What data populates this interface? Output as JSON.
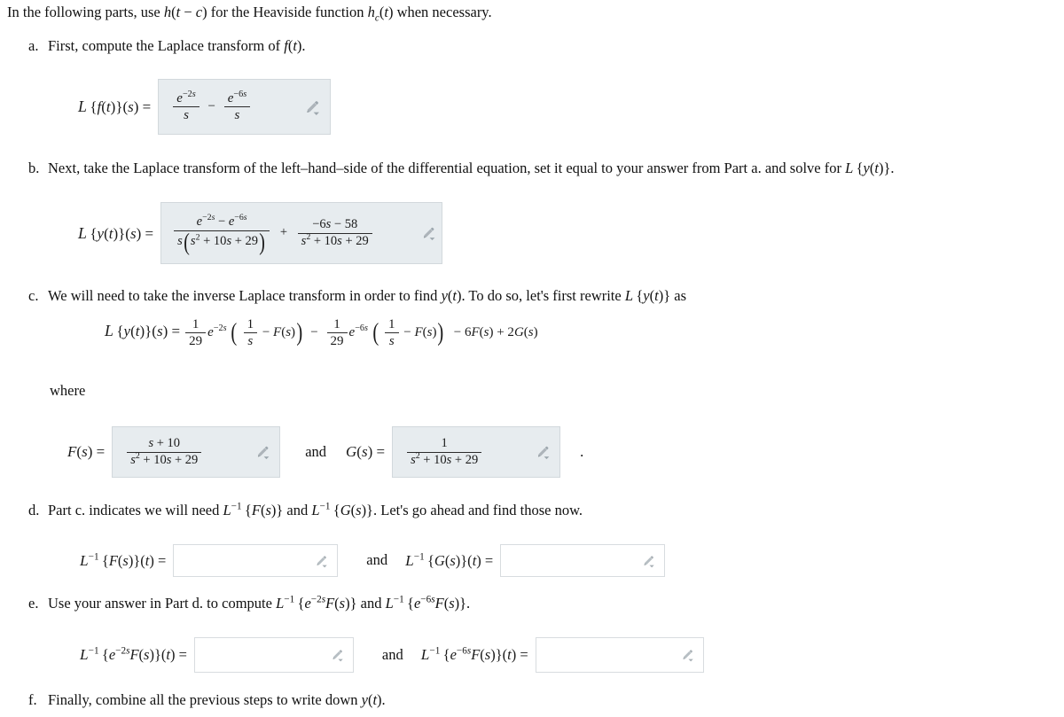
{
  "document": {
    "intro": {
      "before": "In the following parts, use ",
      "math1": "h(t − c)",
      "middle": " for the Heaviside function ",
      "math2": "h_c(t)",
      "after": " when necessary."
    },
    "parts": [
      {
        "label": "a.",
        "text_before": "First, compute the Laplace transform of ",
        "text_math": "f(t)",
        "text_after": "."
      },
      {
        "label": "b.",
        "text_before": "Next, take the Laplace transform of the left–hand–side of the differential equation, set it equal to your answer from Part a. and solve for ",
        "text_math": "L{y(t)}",
        "text_after": "."
      },
      {
        "label": "c.",
        "text_before": "We will need to take the inverse Laplace transform in order to find ",
        "text_math": "y(t)",
        "text_mid": ". To do so, let's first rewrite ",
        "text_math2": "L{y(t)}",
        "text_after": " as"
      },
      {
        "label": "d.",
        "text_before": "Part c. indicates we will need ",
        "text_math": "L⁻¹{F(s)}",
        "text_mid": " and ",
        "text_math2": "L⁻¹{G(s)}",
        "text_after": ". Let's go ahead and find those now."
      },
      {
        "label": "e.",
        "text_before": "Use your answer in Part d. to compute ",
        "text_math": "L⁻¹{e^(−2s)F(s)}",
        "text_mid": " and ",
        "text_math2": "L⁻¹{e^(−6s)F(s)}",
        "text_after": "."
      },
      {
        "label": "f.",
        "text_before": "Finally, combine all the previous steps to write down ",
        "text_math": "y(t)",
        "text_after": "."
      }
    ],
    "where_label": "where",
    "and_label": "and",
    "period_label": ".",
    "equations": {
      "a_lhs": "L {f(t)}(s) =",
      "a_answer": {
        "term1_num": "e",
        "term1_num_exp": "−2s",
        "term1_den": "s",
        "operator": "−",
        "term2_num": "e",
        "term2_num_exp": "−6s",
        "term2_den": "s"
      },
      "b_lhs": "L {y(t)}(s) =",
      "b_answer": {
        "frac1_num_a": "e",
        "frac1_num_a_exp": "−2s",
        "frac1_num_minus": "−",
        "frac1_num_b": "e",
        "frac1_num_b_exp": "−6s",
        "frac1_den": "s(s² + 10s + 29)",
        "operator": "+",
        "frac2_num": "−6s − 58",
        "frac2_den": "s² + 10s + 29"
      },
      "c_display": {
        "lhs": "L {y(t)}(s) =",
        "coef1_num": "1",
        "coef1_den": "29",
        "exp1_base": "e",
        "exp1_exp": "−2s",
        "group1_num": "1",
        "group1_den": "s",
        "group1_minus": "−",
        "group1_F": "F(s)",
        "mid_minus": "−",
        "coef2_num": "1",
        "coef2_den": "29",
        "exp2_base": "e",
        "exp2_exp": "−6s",
        "group2_num": "1",
        "group2_den": "s",
        "group2_minus": "−",
        "group2_F": "F(s)",
        "tail": "− 6F(s) + 2G(s)"
      },
      "F_lhs": "F(s) =",
      "F_answer": {
        "num": "s + 10",
        "den": "s² + 10s + 29"
      },
      "G_lhs": "G(s) =",
      "G_answer": {
        "num": "1",
        "den": "s² + 10s + 29"
      },
      "d_left_lhs": "L⁻¹ {F(s)}(t) =",
      "d_left_value": "",
      "d_right_lhs": "L⁻¹ {G(s)}(t) =",
      "d_right_value": "",
      "e_left_lhs": "L⁻¹ {e^(−2s)F(s)}(t) =",
      "e_left_value": "",
      "e_right_lhs": "L⁻¹ {e^(−6s)F(s)}(t) =",
      "e_right_value": ""
    },
    "icons": {
      "edit_pencil": "pencil-dropdown-icon"
    },
    "colors": {
      "answer_box_fill": "#e7ecef",
      "answer_box_border": "#d2d8dc",
      "empty_box_fill": "#ffffff",
      "empty_box_border": "#d8dcdf",
      "text": "#1a1a1a",
      "pencil_icon": "#9aa4ab"
    }
  }
}
